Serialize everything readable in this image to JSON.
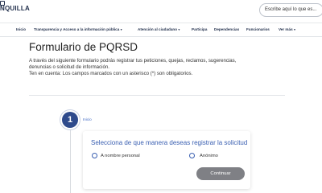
{
  "header": {
    "logo_text": "NQUILLA",
    "search_placeholder": "Escribe aquí lo que es..."
  },
  "nav": {
    "items": [
      {
        "label": "Inicio"
      },
      {
        "label": "Transparencia y Acceso a la información pública",
        "caret": "▾"
      },
      {
        "label": "Atención al ciudadano",
        "caret": "▾"
      },
      {
        "label": "Participa"
      },
      {
        "label": "Dependencias"
      },
      {
        "label": "Funcionarios"
      },
      {
        "label": "Ver más",
        "caret": "▾"
      }
    ]
  },
  "main": {
    "title": "Formulario de PQRSD",
    "paragraph_lines": [
      "A través del siguiente formulario podrás registrar tus peticiones, quejas, reclamos, sugerencias,",
      "denuncias o solicitud de información.",
      "Ten en cuenta: Los campos marcados con un asterisco (*) son obligatorios."
    ]
  },
  "stepper": {
    "step_number": "1",
    "step_label": "Inicio"
  },
  "card": {
    "title": "Selecciona de que manera deseas registrar la solicitud",
    "options": [
      "A nombre personal",
      "Anónimo"
    ],
    "continue_label": "Continuar"
  },
  "colors": {
    "primary_blue": "#2e4a8c",
    "link_blue": "#3a5fb1",
    "button_gray": "#7f8085",
    "nav_text": "#1f2d4a"
  }
}
